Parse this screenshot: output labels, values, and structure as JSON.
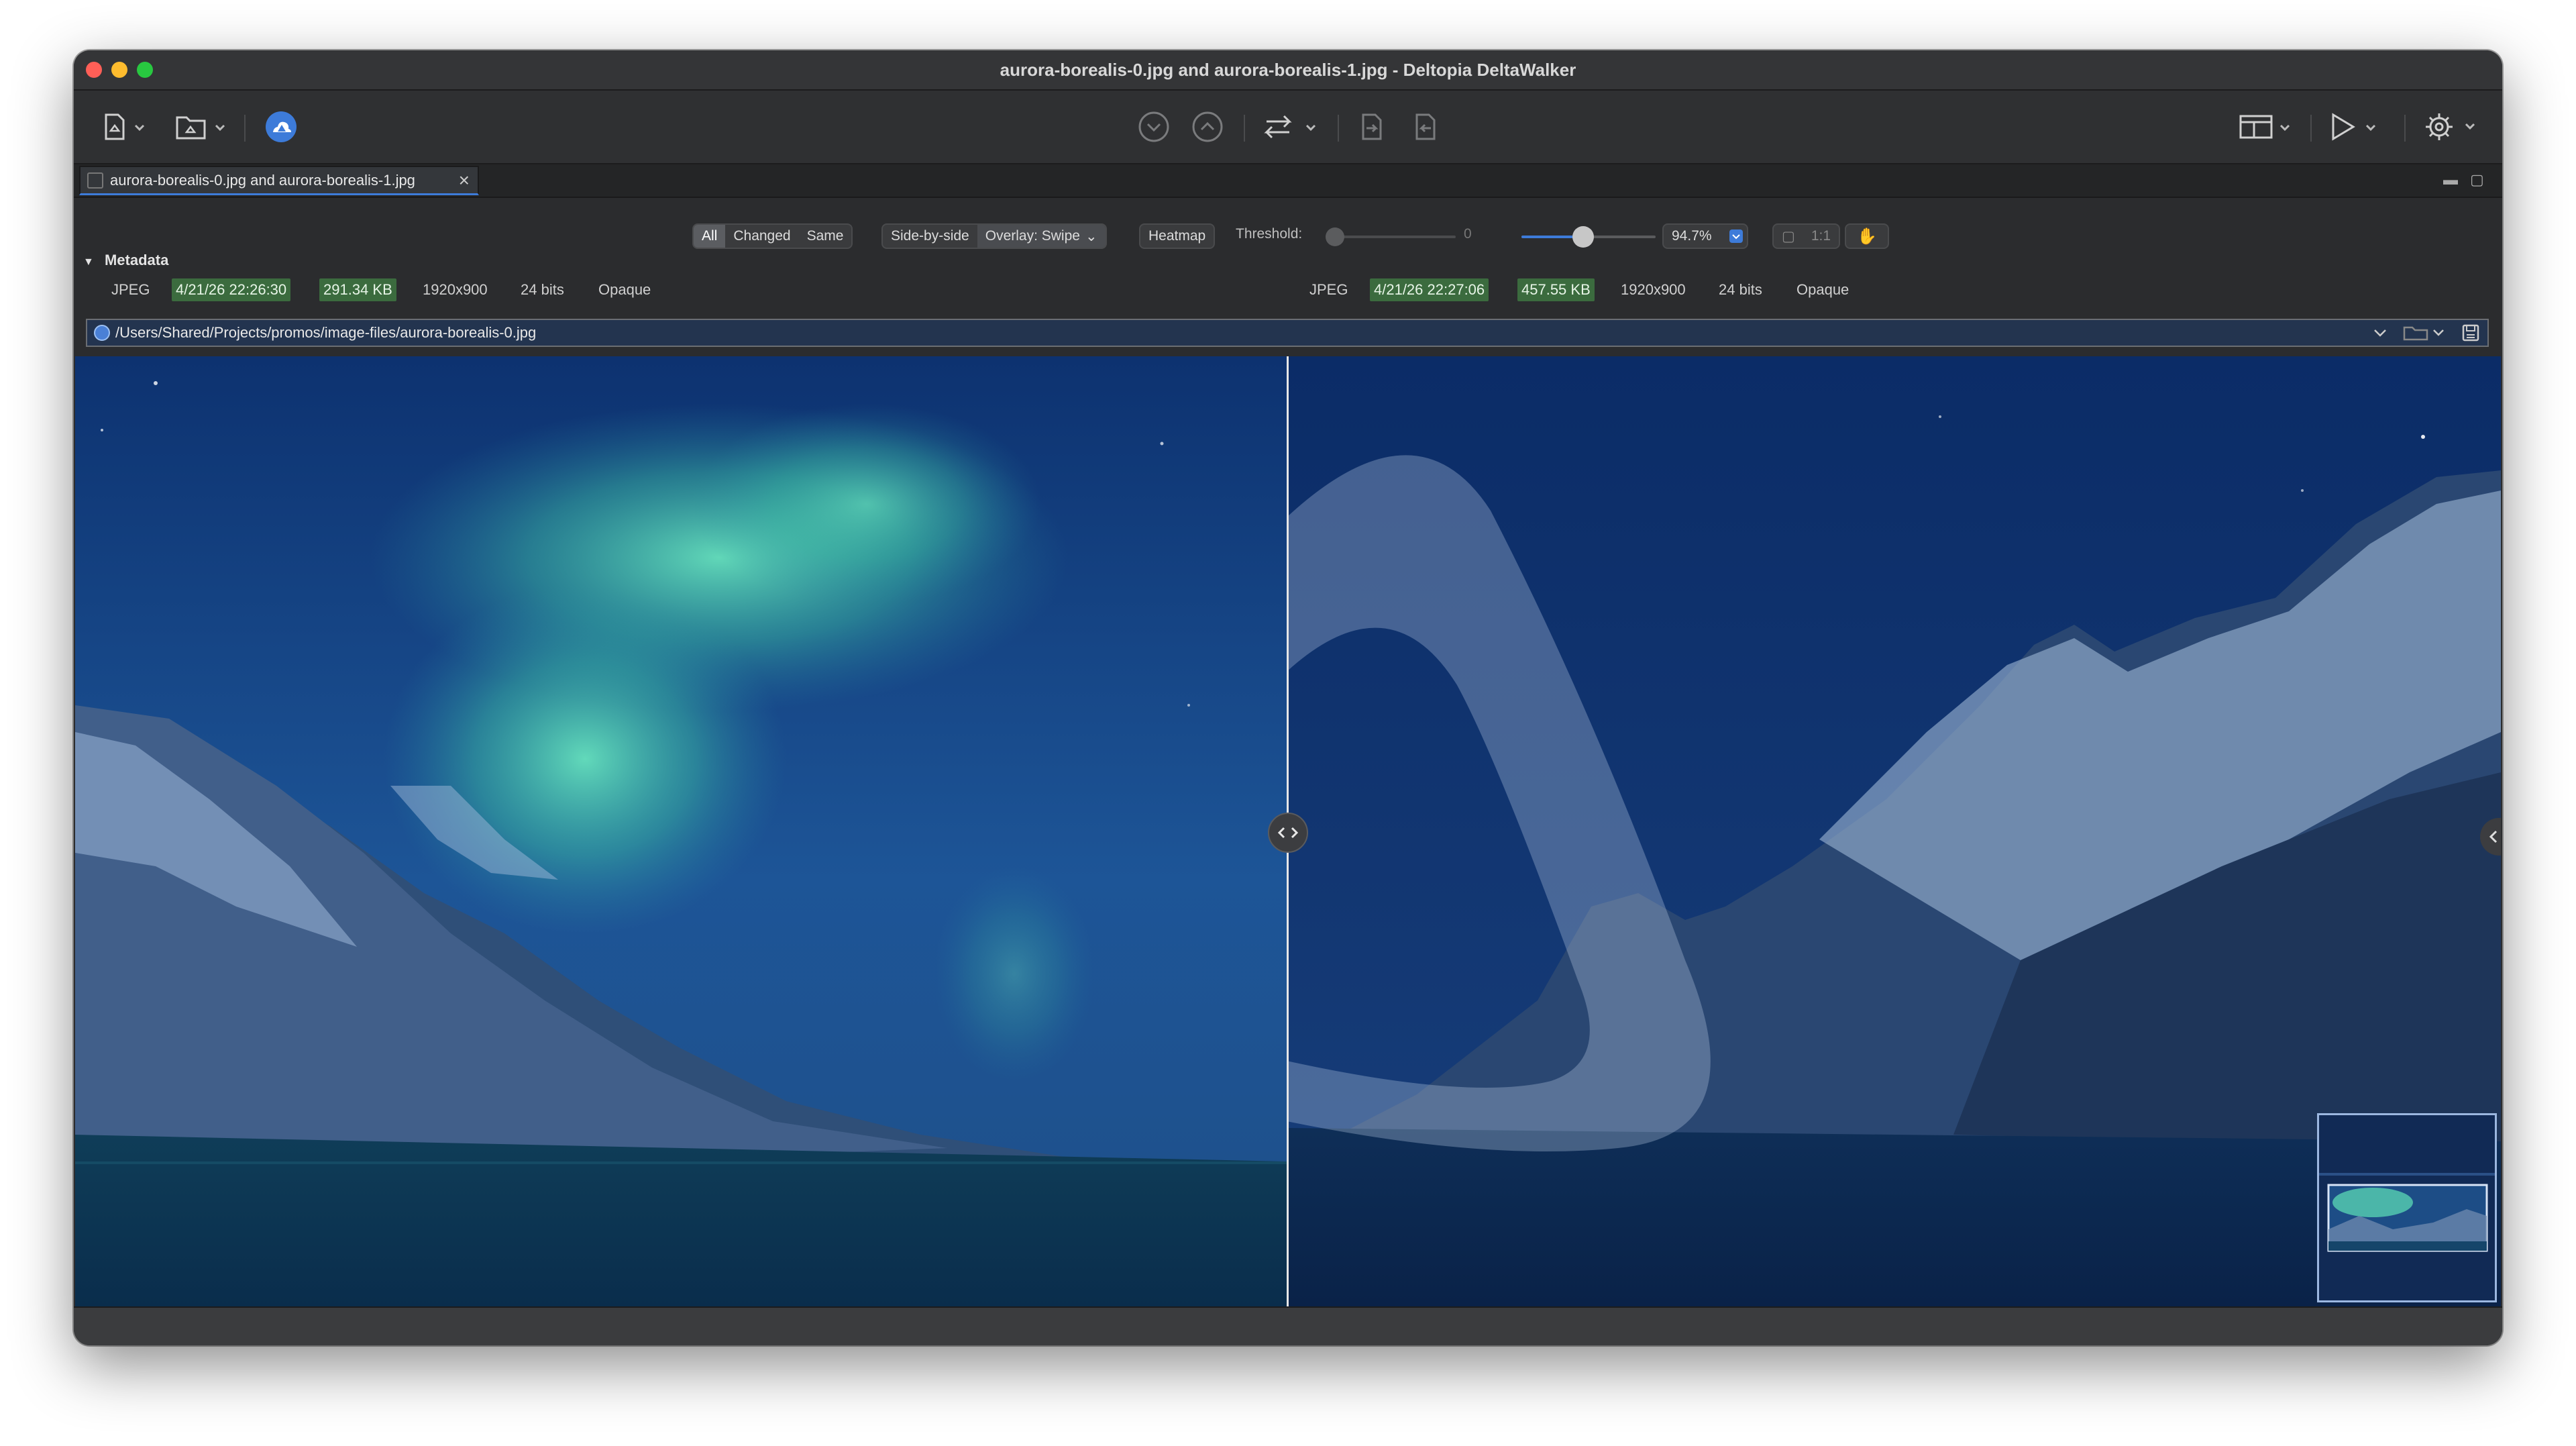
{
  "window": {
    "title": "aurora-borealis-0.jpg and aurora-borealis-1.jpg - Deltopia DeltaWalker"
  },
  "toolbar": {
    "icons": [
      "new-file-compare-icon",
      "new-folder-compare-icon",
      "deltawalker-cloud-icon",
      "next-difference-icon",
      "previous-difference-icon",
      "swap-icon",
      "copy-right-icon",
      "copy-left-icon",
      "layout-icon",
      "run-icon",
      "settings-icon"
    ]
  },
  "tab": {
    "label": "aurora-borealis-0.jpg and aurora-borealis-1.jpg"
  },
  "controls": {
    "filter": [
      "All",
      "Changed",
      "Same"
    ],
    "mode_side": "Side-by-side",
    "mode_overlay": "Overlay: Swipe",
    "heatmap": "Heatmap",
    "threshold_label": "Threshold:",
    "threshold_value": "0",
    "threshold_level": 0,
    "zoom_value": "94.7%",
    "zoom_level": 0.5,
    "actual_size": "1:1"
  },
  "metadata": {
    "header": "Metadata",
    "left": {
      "format": "JPEG",
      "date": "4/21/26 22:26:30",
      "size": "291.34 KB",
      "dims": "1920x900",
      "bits": "24 bits",
      "alpha": "Opaque"
    },
    "right": {
      "format": "JPEG",
      "date": "4/21/26 22:27:06",
      "size": "457.55 KB",
      "dims": "1920x900",
      "bits": "24 bits",
      "alpha": "Opaque"
    }
  },
  "pathbar": {
    "path": "/Users/Shared/Projects/promos/image-files/aurora-borealis-0.jpg"
  },
  "colors": {
    "accent": "#3d7bd9",
    "changed": "#3b6b3e"
  }
}
